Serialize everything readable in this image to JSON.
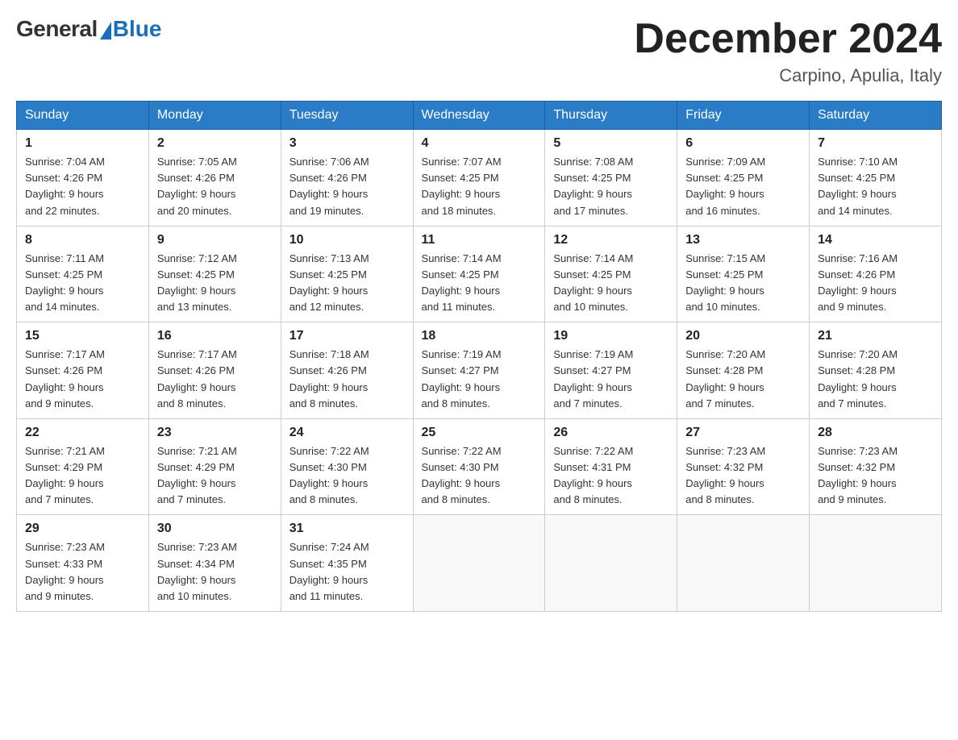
{
  "header": {
    "logo_general": "General",
    "logo_blue": "Blue",
    "month_title": "December 2024",
    "location": "Carpino, Apulia, Italy"
  },
  "days_of_week": [
    "Sunday",
    "Monday",
    "Tuesday",
    "Wednesday",
    "Thursday",
    "Friday",
    "Saturday"
  ],
  "weeks": [
    [
      {
        "day": "1",
        "sunrise": "7:04 AM",
        "sunset": "4:26 PM",
        "daylight": "9 hours and 22 minutes."
      },
      {
        "day": "2",
        "sunrise": "7:05 AM",
        "sunset": "4:26 PM",
        "daylight": "9 hours and 20 minutes."
      },
      {
        "day": "3",
        "sunrise": "7:06 AM",
        "sunset": "4:26 PM",
        "daylight": "9 hours and 19 minutes."
      },
      {
        "day": "4",
        "sunrise": "7:07 AM",
        "sunset": "4:25 PM",
        "daylight": "9 hours and 18 minutes."
      },
      {
        "day": "5",
        "sunrise": "7:08 AM",
        "sunset": "4:25 PM",
        "daylight": "9 hours and 17 minutes."
      },
      {
        "day": "6",
        "sunrise": "7:09 AM",
        "sunset": "4:25 PM",
        "daylight": "9 hours and 16 minutes."
      },
      {
        "day": "7",
        "sunrise": "7:10 AM",
        "sunset": "4:25 PM",
        "daylight": "9 hours and 14 minutes."
      }
    ],
    [
      {
        "day": "8",
        "sunrise": "7:11 AM",
        "sunset": "4:25 PM",
        "daylight": "9 hours and 14 minutes."
      },
      {
        "day": "9",
        "sunrise": "7:12 AM",
        "sunset": "4:25 PM",
        "daylight": "9 hours and 13 minutes."
      },
      {
        "day": "10",
        "sunrise": "7:13 AM",
        "sunset": "4:25 PM",
        "daylight": "9 hours and 12 minutes."
      },
      {
        "day": "11",
        "sunrise": "7:14 AM",
        "sunset": "4:25 PM",
        "daylight": "9 hours and 11 minutes."
      },
      {
        "day": "12",
        "sunrise": "7:14 AM",
        "sunset": "4:25 PM",
        "daylight": "9 hours and 10 minutes."
      },
      {
        "day": "13",
        "sunrise": "7:15 AM",
        "sunset": "4:25 PM",
        "daylight": "9 hours and 10 minutes."
      },
      {
        "day": "14",
        "sunrise": "7:16 AM",
        "sunset": "4:26 PM",
        "daylight": "9 hours and 9 minutes."
      }
    ],
    [
      {
        "day": "15",
        "sunrise": "7:17 AM",
        "sunset": "4:26 PM",
        "daylight": "9 hours and 9 minutes."
      },
      {
        "day": "16",
        "sunrise": "7:17 AM",
        "sunset": "4:26 PM",
        "daylight": "9 hours and 8 minutes."
      },
      {
        "day": "17",
        "sunrise": "7:18 AM",
        "sunset": "4:26 PM",
        "daylight": "9 hours and 8 minutes."
      },
      {
        "day": "18",
        "sunrise": "7:19 AM",
        "sunset": "4:27 PM",
        "daylight": "9 hours and 8 minutes."
      },
      {
        "day": "19",
        "sunrise": "7:19 AM",
        "sunset": "4:27 PM",
        "daylight": "9 hours and 7 minutes."
      },
      {
        "day": "20",
        "sunrise": "7:20 AM",
        "sunset": "4:28 PM",
        "daylight": "9 hours and 7 minutes."
      },
      {
        "day": "21",
        "sunrise": "7:20 AM",
        "sunset": "4:28 PM",
        "daylight": "9 hours and 7 minutes."
      }
    ],
    [
      {
        "day": "22",
        "sunrise": "7:21 AM",
        "sunset": "4:29 PM",
        "daylight": "9 hours and 7 minutes."
      },
      {
        "day": "23",
        "sunrise": "7:21 AM",
        "sunset": "4:29 PM",
        "daylight": "9 hours and 7 minutes."
      },
      {
        "day": "24",
        "sunrise": "7:22 AM",
        "sunset": "4:30 PM",
        "daylight": "9 hours and 8 minutes."
      },
      {
        "day": "25",
        "sunrise": "7:22 AM",
        "sunset": "4:30 PM",
        "daylight": "9 hours and 8 minutes."
      },
      {
        "day": "26",
        "sunrise": "7:22 AM",
        "sunset": "4:31 PM",
        "daylight": "9 hours and 8 minutes."
      },
      {
        "day": "27",
        "sunrise": "7:23 AM",
        "sunset": "4:32 PM",
        "daylight": "9 hours and 8 minutes."
      },
      {
        "day": "28",
        "sunrise": "7:23 AM",
        "sunset": "4:32 PM",
        "daylight": "9 hours and 9 minutes."
      }
    ],
    [
      {
        "day": "29",
        "sunrise": "7:23 AM",
        "sunset": "4:33 PM",
        "daylight": "9 hours and 9 minutes."
      },
      {
        "day": "30",
        "sunrise": "7:23 AM",
        "sunset": "4:34 PM",
        "daylight": "9 hours and 10 minutes."
      },
      {
        "day": "31",
        "sunrise": "7:24 AM",
        "sunset": "4:35 PM",
        "daylight": "9 hours and 11 minutes."
      },
      null,
      null,
      null,
      null
    ]
  ]
}
